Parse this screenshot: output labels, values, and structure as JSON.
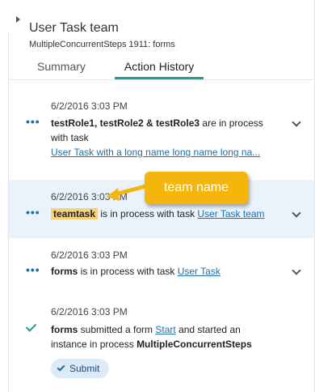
{
  "header": {
    "title": "User Task team",
    "subtitle": "MultipleConcurrentSteps 1911: forms"
  },
  "tabs": [
    {
      "label": "Summary",
      "active": false
    },
    {
      "label": "Action History",
      "active": true
    }
  ],
  "history": [
    {
      "timestamp": "6/2/2016 3:03 PM",
      "actor": "testRole1, testRole2 & testRole3",
      "text1": " are in process",
      "text2": "with task",
      "link": "User Task with a long name long name long na..."
    },
    {
      "timestamp": "6/2/2016 3:03 PM",
      "actor": "teamtask",
      "text1": " is in process with task ",
      "link": "User Task team"
    },
    {
      "timestamp": "6/2/2016 3:03 PM",
      "actor": "forms",
      "text1": " is in process with task ",
      "link": "User Task"
    },
    {
      "timestamp": "6/2/2016 3:03 PM",
      "actor": "forms",
      "text1": " submitted a form ",
      "link": "Start",
      "text2": " and started an",
      "text3": "instance in process ",
      "process": "MultipleConcurrentSteps",
      "badge": "Submit"
    }
  ],
  "annotation": {
    "label": "team name",
    "color": "#f5b60c"
  },
  "colors": {
    "accent": "#1a9e8a",
    "link": "#1f6ea8",
    "highlight_row": "#eaf3fb"
  }
}
